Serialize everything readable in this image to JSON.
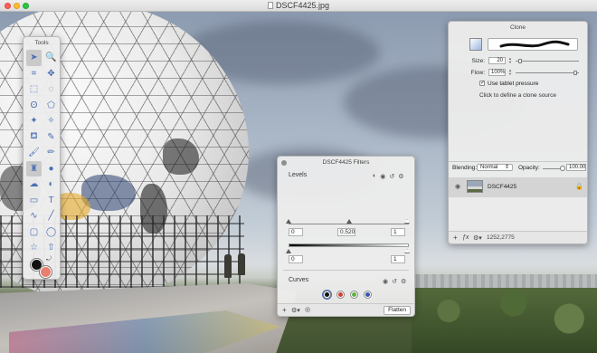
{
  "window": {
    "title": "DSCF4425.jpg"
  },
  "tools_panel": {
    "title": "Tools",
    "tools": [
      {
        "icon": "arrow-icon",
        "glyph": "➤",
        "active": true
      },
      {
        "icon": "zoom-icon",
        "glyph": "🔍"
      },
      {
        "icon": "crop-icon",
        "glyph": "⌗"
      },
      {
        "icon": "move-icon",
        "glyph": "✥"
      },
      {
        "icon": "rect-select-icon",
        "glyph": "⬚"
      },
      {
        "icon": "ellipse-select-icon",
        "glyph": "◌"
      },
      {
        "icon": "lasso-icon",
        "glyph": "ʘ"
      },
      {
        "icon": "polygon-lasso-icon",
        "glyph": "⬠"
      },
      {
        "icon": "magic-wand-icon",
        "glyph": "✦"
      },
      {
        "icon": "quick-select-icon",
        "glyph": "✧"
      },
      {
        "icon": "paint-bucket-icon",
        "glyph": "⛾"
      },
      {
        "icon": "eyedropper-icon",
        "glyph": "✎"
      },
      {
        "icon": "brush-icon",
        "glyph": "🖌"
      },
      {
        "icon": "pencil-icon",
        "glyph": "✏"
      },
      {
        "icon": "clone-stamp-icon",
        "glyph": "♜",
        "active": true
      },
      {
        "icon": "burn-icon",
        "glyph": "●"
      },
      {
        "icon": "smudge-icon",
        "glyph": "☁"
      },
      {
        "icon": "dodge-icon",
        "glyph": "◐"
      },
      {
        "icon": "gradient-icon",
        "glyph": "▭"
      },
      {
        "icon": "text-icon",
        "glyph": "T"
      },
      {
        "icon": "bezier-icon",
        "glyph": "∿"
      },
      {
        "icon": "line-icon",
        "glyph": "╱"
      },
      {
        "icon": "rectangle-shape-icon",
        "glyph": "▢"
      },
      {
        "icon": "ellipse-shape-icon",
        "glyph": "◯"
      },
      {
        "icon": "star-shape-icon",
        "glyph": "☆"
      },
      {
        "icon": "arrow-shape-icon",
        "glyph": "⇧"
      }
    ],
    "colors": {
      "foreground": "#111111",
      "background": "#e97f6f"
    }
  },
  "filters_panel": {
    "title": "DSCF4425 Filters",
    "levels": {
      "label": "Levels",
      "input_black": "0",
      "input_gamma": "0.520",
      "input_white": "1",
      "output_black": "0",
      "output_white": "1"
    },
    "curves": {
      "label": "Curves",
      "channels": [
        {
          "name": "rgb",
          "color": "#111111",
          "selected": true
        },
        {
          "name": "red",
          "color": "#d0412c"
        },
        {
          "name": "green",
          "color": "#5db346"
        },
        {
          "name": "blue",
          "color": "#3555b5"
        }
      ]
    },
    "footer": {
      "add": "+",
      "fx": "ƒx",
      "gear": "⚙▾",
      "flatten": "Flatten"
    }
  },
  "clone_panel": {
    "title": "Clone",
    "size_label": "Size:",
    "size_value": "20",
    "flow_label": "Flow:",
    "flow_value": "100%",
    "tablet_pressure_label": "Use tablet pressure",
    "tablet_pressure_checked": true,
    "hint": "Click to define a clone source",
    "blending_label": "Blending:",
    "blending_value": "Normal",
    "opacity_label": "Opacity:",
    "opacity_value": "100.00",
    "layer_name": "DSCF4425",
    "footer": {
      "add": "+",
      "fx": "ƒx",
      "gear": "⚙▾",
      "coords": "1252,2775"
    }
  }
}
